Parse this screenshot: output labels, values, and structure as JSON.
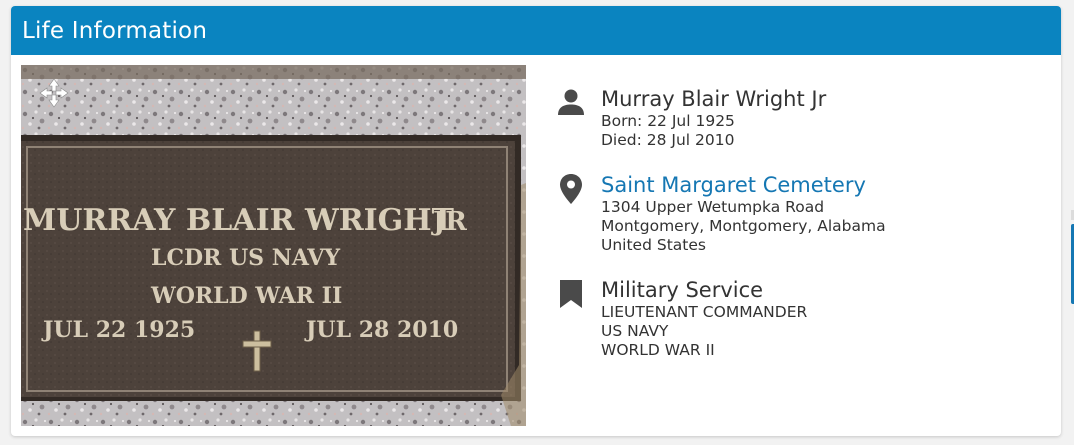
{
  "header": {
    "title": "Life Information"
  },
  "photo": {
    "move_icon": "move-arrows-icon",
    "plaque": {
      "line1": "MURRAY BLAIR WRIGHT",
      "line1_suffix": "JR",
      "line2": "LCDR US NAVY",
      "line3": "WORLD WAR II",
      "born": "JUL 22 1925",
      "died": "JUL 28 2010"
    }
  },
  "person": {
    "icon": "person-icon",
    "name": "Murray Blair Wright Jr",
    "born": "Born: 22 Jul 1925",
    "died": "Died: 28 Jul 2010"
  },
  "cemetery": {
    "icon": "map-pin-icon",
    "name": "Saint Margaret Cemetery",
    "address1": "1304 Upper Wetumpka Road",
    "address2": "Montgomery, Montgomery, Alabama",
    "country": "United States"
  },
  "military": {
    "icon": "bookmark-icon",
    "title": "Military Service",
    "rank": "LIEUTENANT COMMANDER",
    "branch": "US NAVY",
    "war": "WORLD WAR II"
  },
  "colors": {
    "header_bg": "#0a84c0",
    "link": "#1577b3",
    "text": "#333333",
    "plaque": "#4a3f38",
    "granite": "#c9c6c8"
  }
}
